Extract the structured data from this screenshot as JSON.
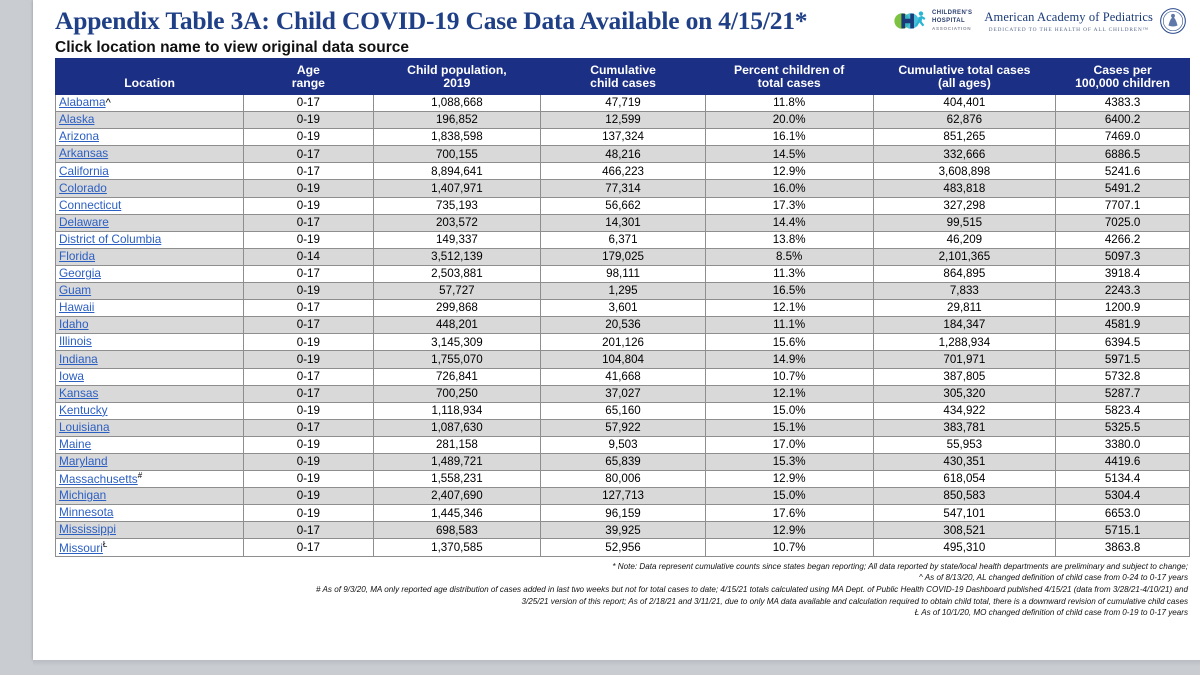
{
  "header": {
    "title": "Appendix Table 3A: Child COVID-19 Case Data Available on 4/15/21*",
    "subtitle": "Click location name to view original data source",
    "cha_logo": {
      "line1": "CHILDREN'S",
      "line2": "HOSPITAL",
      "line3": "ASSOCIATION"
    },
    "aap_logo": {
      "name": "American Academy of Pediatrics",
      "tagline": "DEDICATED TO THE HEALTH OF ALL CHILDREN™"
    }
  },
  "table": {
    "columns": [
      "Location",
      "Age range",
      "Child population, 2019",
      "Cumulative child cases",
      "Percent children of total cases",
      "Cumulative total cases (all ages)",
      "Cases per 100,000 children"
    ],
    "columns_lines": [
      [
        "Location"
      ],
      [
        "Age",
        "range"
      ],
      [
        "Child population,",
        "2019"
      ],
      [
        "Cumulative",
        "child cases"
      ],
      [
        "Percent children of",
        "total cases"
      ],
      [
        "Cumulative total cases",
        "(all ages)"
      ],
      [
        "Cases per",
        "100,000 children"
      ]
    ],
    "rows": [
      {
        "location": "Alabama",
        "marker": "^",
        "age_range": "0-17",
        "child_population": "1,088,668",
        "child_cases": "47,719",
        "pct_children": "11.8%",
        "total_cases": "404,401",
        "cases_per_100k": "4383.3"
      },
      {
        "location": "Alaska",
        "marker": "",
        "age_range": "0-19",
        "child_population": "196,852",
        "child_cases": "12,599",
        "pct_children": "20.0%",
        "total_cases": "62,876",
        "cases_per_100k": "6400.2"
      },
      {
        "location": "Arizona",
        "marker": "",
        "age_range": "0-19",
        "child_population": "1,838,598",
        "child_cases": "137,324",
        "pct_children": "16.1%",
        "total_cases": "851,265",
        "cases_per_100k": "7469.0"
      },
      {
        "location": "Arkansas",
        "marker": "",
        "age_range": "0-17",
        "child_population": "700,155",
        "child_cases": "48,216",
        "pct_children": "14.5%",
        "total_cases": "332,666",
        "cases_per_100k": "6886.5"
      },
      {
        "location": "California",
        "marker": "",
        "age_range": "0-17",
        "child_population": "8,894,641",
        "child_cases": "466,223",
        "pct_children": "12.9%",
        "total_cases": "3,608,898",
        "cases_per_100k": "5241.6"
      },
      {
        "location": "Colorado",
        "marker": "",
        "age_range": "0-19",
        "child_population": "1,407,971",
        "child_cases": "77,314",
        "pct_children": "16.0%",
        "total_cases": "483,818",
        "cases_per_100k": "5491.2"
      },
      {
        "location": "Connecticut",
        "marker": "",
        "age_range": "0-19",
        "child_population": "735,193",
        "child_cases": "56,662",
        "pct_children": "17.3%",
        "total_cases": "327,298",
        "cases_per_100k": "7707.1"
      },
      {
        "location": "Delaware",
        "marker": "",
        "age_range": "0-17",
        "child_population": "203,572",
        "child_cases": "14,301",
        "pct_children": "14.4%",
        "total_cases": "99,515",
        "cases_per_100k": "7025.0"
      },
      {
        "location": "District of Columbia",
        "marker": "",
        "age_range": "0-19",
        "child_population": "149,337",
        "child_cases": "6,371",
        "pct_children": "13.8%",
        "total_cases": "46,209",
        "cases_per_100k": "4266.2"
      },
      {
        "location": "Florida",
        "marker": "",
        "age_range": "0-14",
        "child_population": "3,512,139",
        "child_cases": "179,025",
        "pct_children": "8.5%",
        "total_cases": "2,101,365",
        "cases_per_100k": "5097.3"
      },
      {
        "location": "Georgia",
        "marker": "",
        "age_range": "0-17",
        "child_population": "2,503,881",
        "child_cases": "98,111",
        "pct_children": "11.3%",
        "total_cases": "864,895",
        "cases_per_100k": "3918.4"
      },
      {
        "location": "Guam",
        "marker": "",
        "age_range": "0-19",
        "child_population": "57,727",
        "child_cases": "1,295",
        "pct_children": "16.5%",
        "total_cases": "7,833",
        "cases_per_100k": "2243.3"
      },
      {
        "location": "Hawaii",
        "marker": "",
        "age_range": "0-17",
        "child_population": "299,868",
        "child_cases": "3,601",
        "pct_children": "12.1%",
        "total_cases": "29,811",
        "cases_per_100k": "1200.9"
      },
      {
        "location": "Idaho",
        "marker": "",
        "age_range": "0-17",
        "child_population": "448,201",
        "child_cases": "20,536",
        "pct_children": "11.1%",
        "total_cases": "184,347",
        "cases_per_100k": "4581.9"
      },
      {
        "location": "Illinois",
        "marker": "",
        "age_range": "0-19",
        "child_population": "3,145,309",
        "child_cases": "201,126",
        "pct_children": "15.6%",
        "total_cases": "1,288,934",
        "cases_per_100k": "6394.5"
      },
      {
        "location": "Indiana",
        "marker": "",
        "age_range": "0-19",
        "child_population": "1,755,070",
        "child_cases": "104,804",
        "pct_children": "14.9%",
        "total_cases": "701,971",
        "cases_per_100k": "5971.5"
      },
      {
        "location": "Iowa",
        "marker": "",
        "age_range": "0-17",
        "child_population": "726,841",
        "child_cases": "41,668",
        "pct_children": "10.7%",
        "total_cases": "387,805",
        "cases_per_100k": "5732.8"
      },
      {
        "location": "Kansas",
        "marker": "",
        "age_range": "0-17",
        "child_population": "700,250",
        "child_cases": "37,027",
        "pct_children": "12.1%",
        "total_cases": "305,320",
        "cases_per_100k": "5287.7"
      },
      {
        "location": "Kentucky",
        "marker": "",
        "age_range": "0-19",
        "child_population": "1,118,934",
        "child_cases": "65,160",
        "pct_children": "15.0%",
        "total_cases": "434,922",
        "cases_per_100k": "5823.4"
      },
      {
        "location": "Louisiana",
        "marker": "",
        "age_range": "0-17",
        "child_population": "1,087,630",
        "child_cases": "57,922",
        "pct_children": "15.1%",
        "total_cases": "383,781",
        "cases_per_100k": "5325.5"
      },
      {
        "location": "Maine",
        "marker": "",
        "age_range": "0-19",
        "child_population": "281,158",
        "child_cases": "9,503",
        "pct_children": "17.0%",
        "total_cases": "55,953",
        "cases_per_100k": "3380.0"
      },
      {
        "location": "Maryland",
        "marker": "",
        "age_range": "0-19",
        "child_population": "1,489,721",
        "child_cases": "65,839",
        "pct_children": "15.3%",
        "total_cases": "430,351",
        "cases_per_100k": "4419.6"
      },
      {
        "location": "Massachusetts",
        "marker": "#",
        "age_range": "0-19",
        "child_population": "1,558,231",
        "child_cases": "80,006",
        "pct_children": "12.9%",
        "total_cases": "618,054",
        "cases_per_100k": "5134.4"
      },
      {
        "location": "Michigan",
        "marker": "",
        "age_range": "0-19",
        "child_population": "2,407,690",
        "child_cases": "127,713",
        "pct_children": "15.0%",
        "total_cases": "850,583",
        "cases_per_100k": "5304.4"
      },
      {
        "location": "Minnesota",
        "marker": "",
        "age_range": "0-19",
        "child_population": "1,445,346",
        "child_cases": "96,159",
        "pct_children": "17.6%",
        "total_cases": "547,101",
        "cases_per_100k": "6653.0"
      },
      {
        "location": "Mississippi",
        "marker": "",
        "age_range": "0-17",
        "child_population": "698,583",
        "child_cases": "39,925",
        "pct_children": "12.9%",
        "total_cases": "308,521",
        "cases_per_100k": "5715.1"
      },
      {
        "location": "Missouri",
        "marker": "Ł",
        "age_range": "0-17",
        "child_population": "1,370,585",
        "child_cases": "52,956",
        "pct_children": "10.7%",
        "total_cases": "495,310",
        "cases_per_100k": "3863.8"
      }
    ]
  },
  "footnotes": [
    "* Note: Data represent cumulative counts since states began reporting; All data reported by state/local health departments are preliminary and subject to change;",
    "^ As of 8/13/20, AL changed definition of child case from 0-24 to 0-17 years",
    "# As of 9/3/20, MA only reported age distribution of cases added in last two weeks but not for total cases to date; 4/15/21 totals calculated using MA Dept. of Public Health COVID-19 Dashboard published 4/15/21 (data from 3/28/21-4/10/21) and",
    "3/25/21 version of this report; As of 2/18/21 and 3/11/21, due to only MA data available and calculation required to obtain child total, there is a downward revision of cumulative child cases",
    "Ł As of 10/1/20, MO changed definition of child case from 0-19 to 0-17 years"
  ],
  "colors": {
    "header_blue": "#1b2f84",
    "title_blue": "#1f3f86",
    "link_blue": "#2c5fc2",
    "alt_row": "#d9d9d9"
  }
}
